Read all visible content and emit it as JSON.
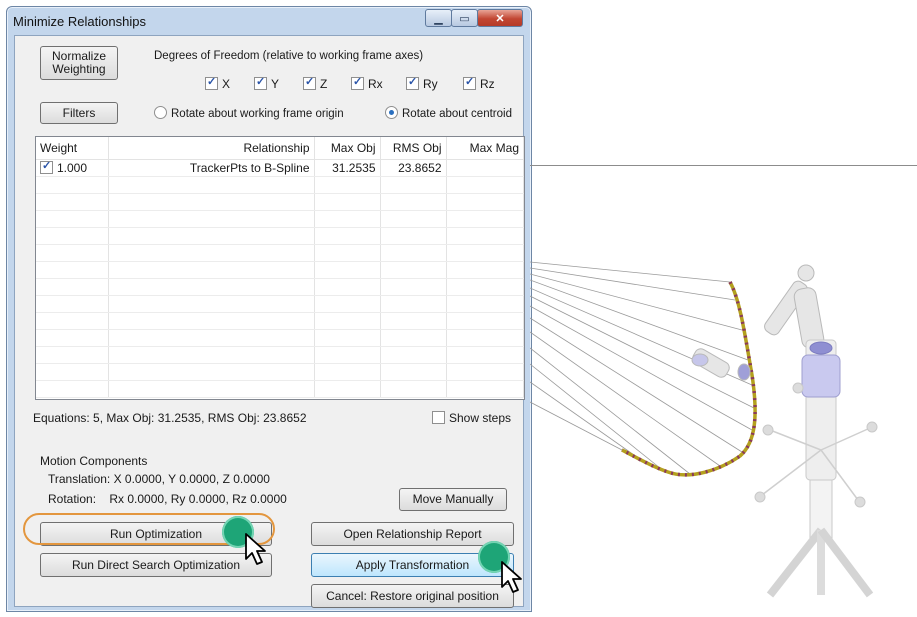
{
  "dialog": {
    "title": "Minimize Relationships",
    "normalize_button": "Normalize\nWeighting",
    "filters_button": "Filters",
    "dof_label": "Degrees of Freedom (relative to working frame axes)",
    "dof": [
      {
        "label": "X",
        "checked": true
      },
      {
        "label": "Y",
        "checked": true
      },
      {
        "label": "Z",
        "checked": true
      },
      {
        "label": "Rx",
        "checked": true
      },
      {
        "label": "Ry",
        "checked": true
      },
      {
        "label": "Rz",
        "checked": true
      }
    ],
    "rotate_origin": "Rotate about working frame origin",
    "rotate_centroid": "Rotate about centroid",
    "rotate_selected": "centroid",
    "table": {
      "columns": [
        "Weight",
        "Relationship",
        "Max Obj",
        "RMS Obj",
        "Max Mag"
      ],
      "rows": [
        {
          "checked": true,
          "weight": "1.000",
          "relationship": "TrackerPts to B-Spline",
          "max_obj": "31.2535",
          "rms_obj": "23.8652",
          "max_mag": ""
        }
      ]
    },
    "equations": "Equations: 5, Max Obj: 31.2535, RMS Obj: 23.8652",
    "show_steps": "Show steps",
    "motion_title": "Motion Components",
    "translation": "Translation:  X 0.0000, Y 0.0000, Z 0.0000",
    "rotation": "Rotation:    Rx 0.0000, Ry 0.0000, Rz 0.0000",
    "move_manually": "Move Manually",
    "run_optimization": "Run Optimization",
    "run_direct": "Run Direct Search Optimization",
    "open_report": "Open Relationship Report",
    "apply_transformation": "Apply Transformation",
    "cancel": "Cancel: Restore original position"
  },
  "colors": {
    "highlight": "#e3963e",
    "click_marker": "#1ea577",
    "curve": "#b4a01e"
  }
}
